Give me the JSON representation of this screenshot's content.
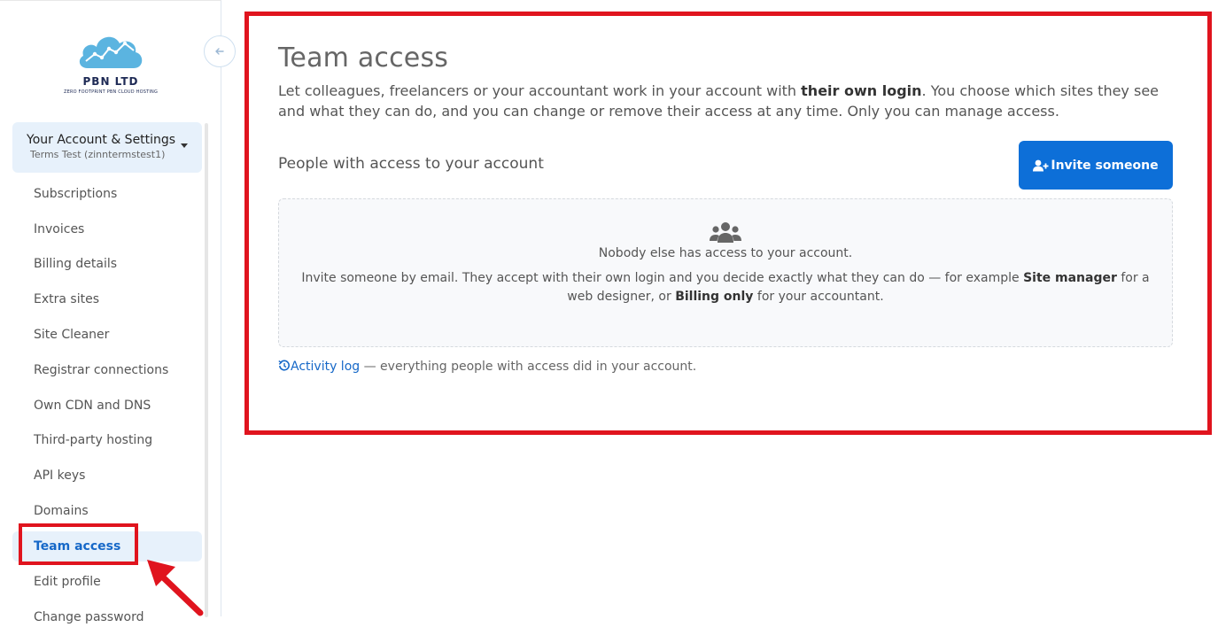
{
  "brand": {
    "name": "PBN LTD",
    "tagline": "ZERO FOOTPRINT PBN CLOUD HOSTING",
    "accent": "#0d6fd8"
  },
  "sidebar": {
    "collapse_icon": "arrow-left-icon",
    "account": {
      "title": "Your Account & Settings",
      "subtitle": "Terms Test (zinntermstest1)"
    },
    "items": [
      {
        "label": "Subscriptions"
      },
      {
        "label": "Invoices"
      },
      {
        "label": "Billing details"
      },
      {
        "label": "Extra sites"
      },
      {
        "label": "Site Cleaner"
      },
      {
        "label": "Registrar connections"
      },
      {
        "label": "Own CDN and DNS"
      },
      {
        "label": "Third-party hosting"
      },
      {
        "label": "API keys"
      },
      {
        "label": "Domains"
      },
      {
        "label": "Team access",
        "active": true
      },
      {
        "label": "Edit profile"
      },
      {
        "label": "Change password"
      }
    ]
  },
  "main": {
    "title": "Team access",
    "intro_part1": "Let colleagues, freelancers or your accountant work in your account with ",
    "intro_bold": "their own login",
    "intro_part2": ". You choose which sites they see and what they can do, and you can change or remove their access at any time. Only you can manage access.",
    "section_title": "People with access to your account",
    "invite_label": "Invite someone",
    "empty": {
      "icon": "users-icon",
      "title": "Nobody else has access to your account.",
      "text_part1": "Invite someone by email. They accept with their own login and you decide exactly what they can do — for example ",
      "bold1": "Site manager",
      "text_part2": " for a web designer, or ",
      "bold2": "Billing only",
      "text_part3": " for your accountant."
    },
    "activity": {
      "link_label": "Activity log",
      "text": " — everything people with access did in your account."
    }
  },
  "annotation_color": "#e0141e"
}
